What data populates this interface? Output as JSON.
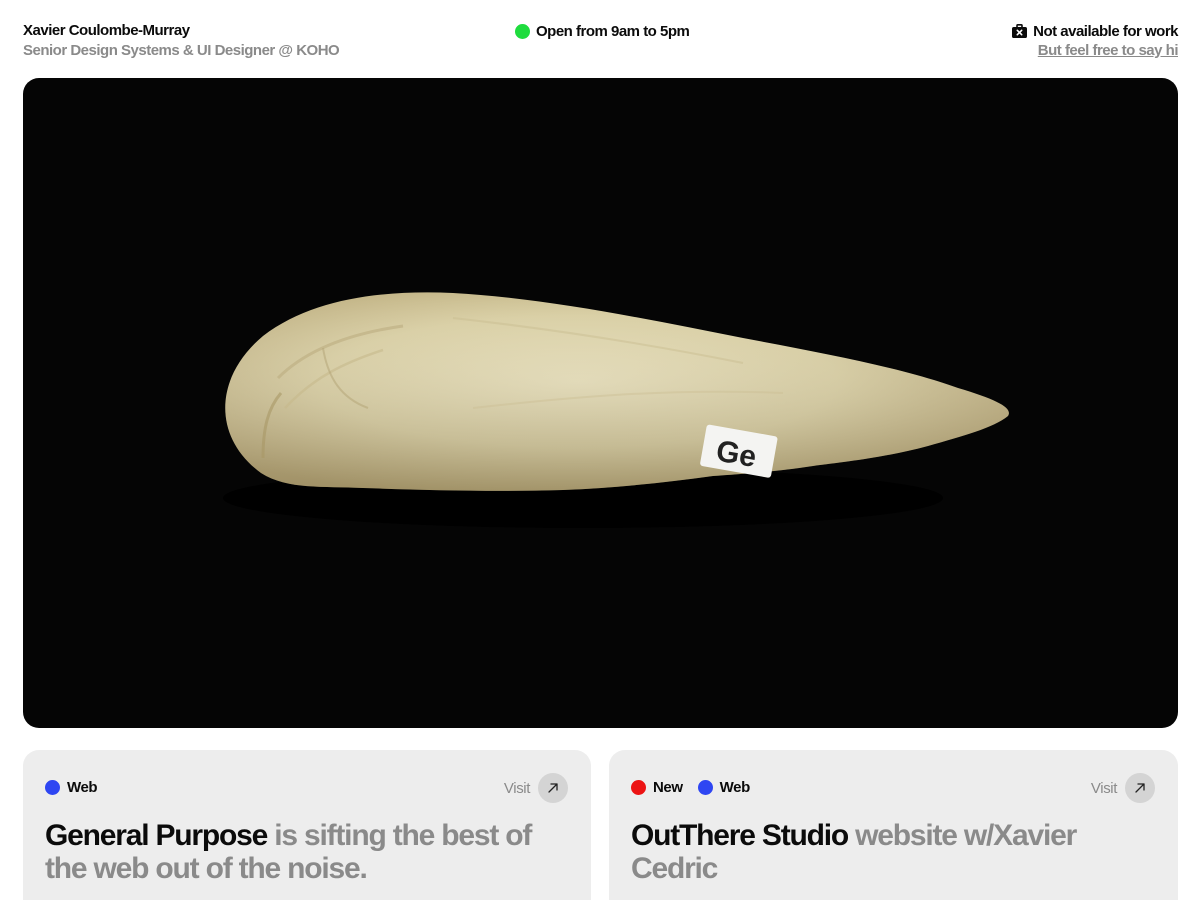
{
  "profile": {
    "name": "Xavier Coulombe-Murray",
    "role": "Senior Design Systems & UI Designer @ KOHO"
  },
  "hours": {
    "text": "Open from 9am to 5pm",
    "status_color": "#1fdc3e"
  },
  "availability": {
    "icon": "briefcase-x-icon",
    "text": "Not available for work",
    "link": "But feel free to say hi"
  },
  "hero": {
    "image": "flint-stone-artifact",
    "label_fragment": "Ge"
  },
  "cards": [
    {
      "tags": [
        {
          "label": "Web",
          "color": "#2e46f2"
        }
      ],
      "visit_label": "Visit",
      "visit_icon": "arrow-up-right-icon",
      "title": "General Purpose",
      "description": " is sifting the best of the web out of the noise."
    },
    {
      "tags": [
        {
          "label": "New",
          "color": "#ec1313"
        },
        {
          "label": "Web",
          "color": "#2e46f2"
        }
      ],
      "visit_label": "Visit",
      "visit_icon": "arrow-up-right-icon",
      "title": "OutThere Studio",
      "description": " website w/Xavier Cedric"
    }
  ]
}
